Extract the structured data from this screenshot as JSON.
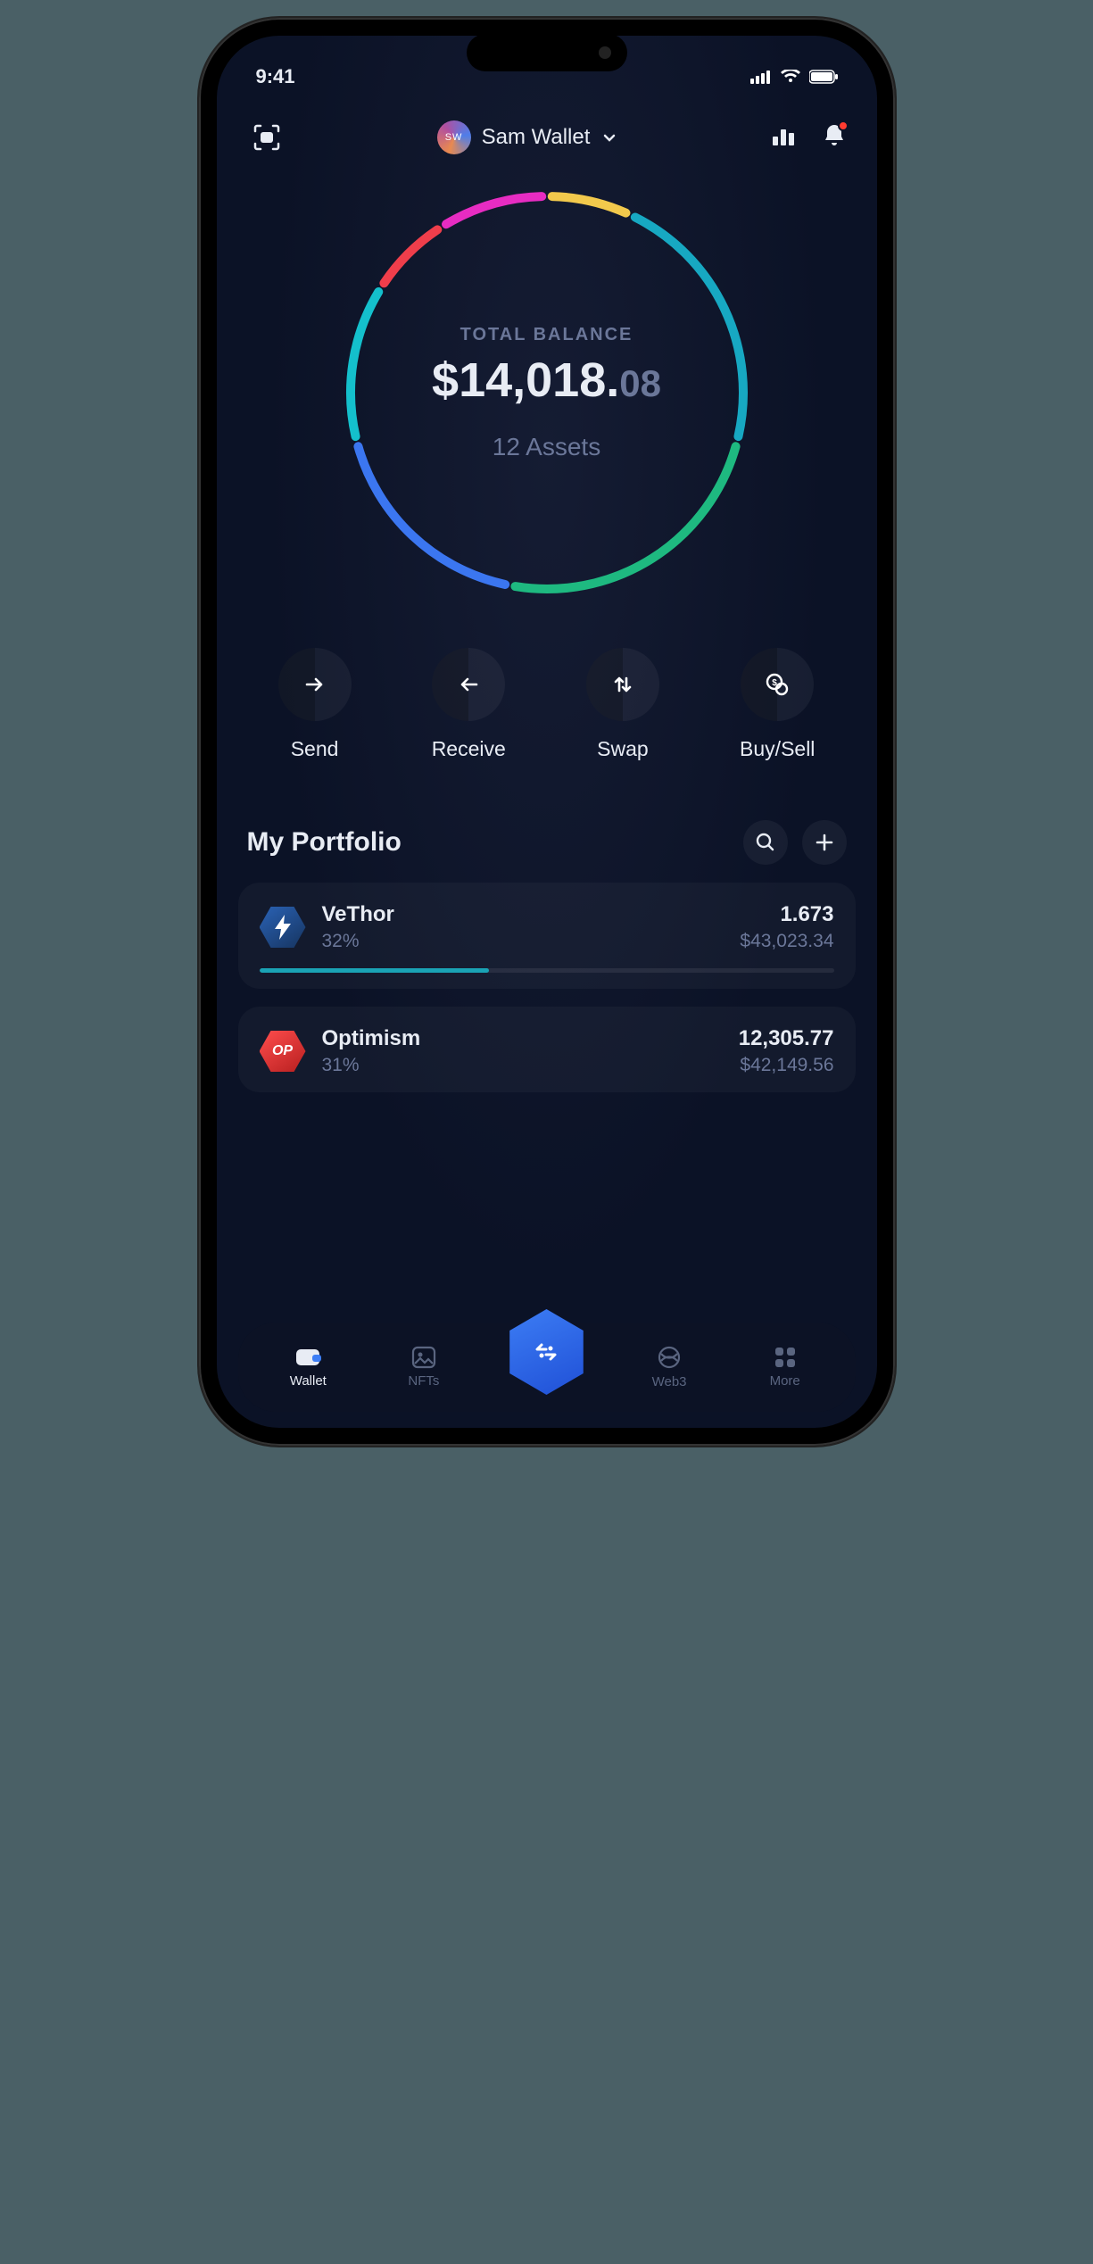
{
  "status": {
    "time": "9:41"
  },
  "header": {
    "avatar_initials": "SW",
    "wallet_name": "Sam Wallet"
  },
  "balance": {
    "label": "TOTAL BALANCE",
    "amount_main": "$14,018.",
    "amount_cents": "08",
    "assets_count": "12 Assets"
  },
  "actions": {
    "send": "Send",
    "receive": "Receive",
    "swap": "Swap",
    "buysell": "Buy/Sell"
  },
  "portfolio": {
    "title": "My Portfolio",
    "items": [
      {
        "name": "VeThor",
        "pct": "32%",
        "amount": "1.673",
        "value": "$43,023.34",
        "progress": 40,
        "badge": "bolt",
        "badge_color": "blue"
      },
      {
        "name": "Optimism",
        "pct": "31%",
        "amount": "12,305.77",
        "value": "$42,149.56",
        "progress": 0,
        "badge": "OP",
        "badge_color": "red"
      }
    ]
  },
  "tabs": {
    "wallet": "Wallet",
    "nfts": "NFTs",
    "web3": "Web3",
    "more": "More"
  },
  "chart_data": {
    "type": "pie",
    "title": "TOTAL BALANCE",
    "series": [
      {
        "name": "segment-1",
        "value": 7,
        "color": "#f2c94c"
      },
      {
        "name": "segment-2",
        "value": 22,
        "color": "#17a8c2"
      },
      {
        "name": "segment-3",
        "value": 24,
        "color": "#1eb980"
      },
      {
        "name": "segment-4",
        "value": 18,
        "color": "#3b76f0"
      },
      {
        "name": "segment-5",
        "value": 13,
        "color": "#14c0cc"
      },
      {
        "name": "segment-6",
        "value": 7,
        "color": "#ef3e4b"
      },
      {
        "name": "segment-7",
        "value": 9,
        "color": "#e72cc2"
      }
    ]
  }
}
